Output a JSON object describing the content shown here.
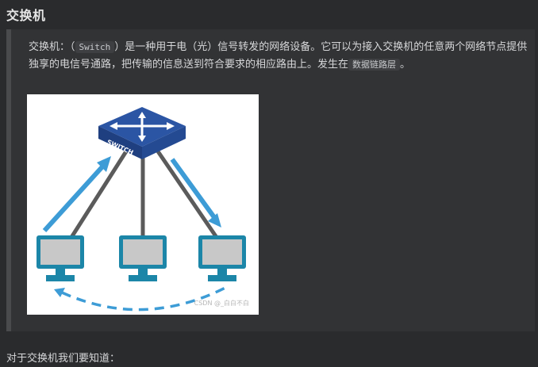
{
  "heading": "交换机",
  "para": {
    "pre": "交换机：（",
    "code1": "Switch",
    "mid": "）是一种用于电（光）信号转发的网络设备。它可以为接入交换机的任意两个网络节点提供独享的电信号通路，把传输的信息送到符合要求的相应路由上。发生在",
    "code2": "数据链路层",
    "post": "。"
  },
  "figure": {
    "switch_label": "SWITCH",
    "watermark": "CSDN @_白白不白",
    "colors": {
      "switch_top": "#2b55a4",
      "switch_side": "#1f3f80",
      "arrow": "#3d9cd6",
      "cable": "#5b5b5b",
      "monitor": "#1c86a8",
      "screen": "#c8c8c8"
    }
  },
  "bottom_text": "对于交换机我们要知道："
}
